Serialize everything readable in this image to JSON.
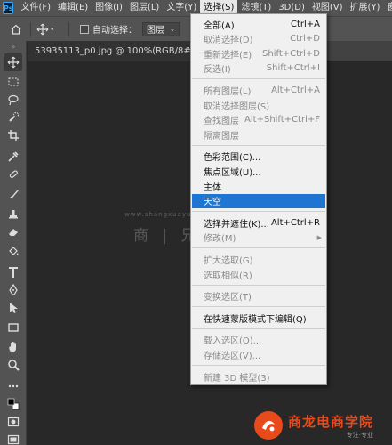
{
  "app": {
    "logo_text": "Ps"
  },
  "menubar": [
    {
      "label": "文件(F)",
      "active": false
    },
    {
      "label": "编辑(E)",
      "active": false
    },
    {
      "label": "图像(I)",
      "active": false
    },
    {
      "label": "图层(L)",
      "active": false
    },
    {
      "label": "文字(Y)",
      "active": false
    },
    {
      "label": "选择(S)",
      "active": true
    },
    {
      "label": "滤镜(T)",
      "active": false
    },
    {
      "label": "3D(D)",
      "active": false
    },
    {
      "label": "视图(V)",
      "active": false
    },
    {
      "label": "扩展(Y)",
      "active": false
    },
    {
      "label": "窗口(W)",
      "active": false
    }
  ],
  "options_bar": {
    "auto_select_label": "自动选择：",
    "auto_select_checked": false,
    "target_value": "图层"
  },
  "document": {
    "tab_title": "53935113_p0.jpg @ 100%(RGB/8#)"
  },
  "select_menu": {
    "items": [
      {
        "label": "全部(A)",
        "shortcut": "Ctrl+A",
        "disabled": false
      },
      {
        "label": "取消选择(D)",
        "shortcut": "Ctrl+D",
        "disabled": true
      },
      {
        "label": "重新选择(E)",
        "shortcut": "Shift+Ctrl+D",
        "disabled": true
      },
      {
        "label": "反选(I)",
        "shortcut": "Shift+Ctrl+I",
        "disabled": true
      },
      {
        "separator": true
      },
      {
        "label": "所有图层(L)",
        "shortcut": "Alt+Ctrl+A",
        "disabled": true
      },
      {
        "label": "取消选择图层(S)",
        "shortcut": "",
        "disabled": true
      },
      {
        "label": "查找图层",
        "shortcut": "Alt+Shift+Ctrl+F",
        "disabled": true
      },
      {
        "label": "隔离图层",
        "shortcut": "",
        "disabled": true
      },
      {
        "separator": true
      },
      {
        "label": "色彩范围(C)...",
        "shortcut": "",
        "disabled": false
      },
      {
        "label": "焦点区域(U)...",
        "shortcut": "",
        "disabled": false
      },
      {
        "label": "主体",
        "shortcut": "",
        "disabled": false
      },
      {
        "label": "天空",
        "shortcut": "",
        "disabled": false,
        "highlight": true
      },
      {
        "separator": true
      },
      {
        "label": "选择并遮住(K)...",
        "shortcut": "Alt+Ctrl+R",
        "disabled": false
      },
      {
        "label": "修改(M)",
        "shortcut": "",
        "disabled": true,
        "submenu": true
      },
      {
        "separator": true
      },
      {
        "label": "扩大选取(G)",
        "shortcut": "",
        "disabled": true
      },
      {
        "label": "选取相似(R)",
        "shortcut": "",
        "disabled": true
      },
      {
        "separator": true
      },
      {
        "label": "变换选区(T)",
        "shortcut": "",
        "disabled": true
      },
      {
        "separator": true
      },
      {
        "label": "在快速蒙版模式下编辑(Q)",
        "shortcut": "",
        "disabled": false
      },
      {
        "separator": true
      },
      {
        "label": "载入选区(O)...",
        "shortcut": "",
        "disabled": true
      },
      {
        "label": "存储选区(V)...",
        "shortcut": "",
        "disabled": true
      },
      {
        "separator": true
      },
      {
        "label": "新建 3D 模型(3)",
        "shortcut": "",
        "disabled": true
      }
    ]
  },
  "tools": [
    {
      "icon": "move-icon",
      "selected": true
    },
    {
      "icon": "marquee-icon"
    },
    {
      "icon": "lasso-icon"
    },
    {
      "icon": "quick-select-icon"
    },
    {
      "icon": "crop-icon"
    },
    {
      "icon": "eyedropper-icon"
    },
    {
      "icon": "healing-brush-icon"
    },
    {
      "icon": "brush-icon"
    },
    {
      "icon": "clone-stamp-icon"
    },
    {
      "icon": "eraser-icon"
    },
    {
      "icon": "paint-bucket-icon"
    },
    {
      "icon": "type-icon"
    },
    {
      "icon": "pen-icon"
    },
    {
      "icon": "path-select-icon"
    },
    {
      "icon": "rectangle-icon"
    },
    {
      "icon": "hand-icon"
    },
    {
      "icon": "zoom-icon"
    },
    {
      "icon": "more-tools-icon"
    },
    {
      "icon": "color-swatches-icon"
    },
    {
      "icon": "quick-mask-icon"
    },
    {
      "icon": "screen-mode-icon"
    }
  ],
  "watermark": {
    "line1": "www.shangxueyuan.com",
    "line2": "商 | 兄 | 山 | 丁 手"
  },
  "logo": {
    "name": "商龙电商学院",
    "tag": "专注·专业"
  }
}
